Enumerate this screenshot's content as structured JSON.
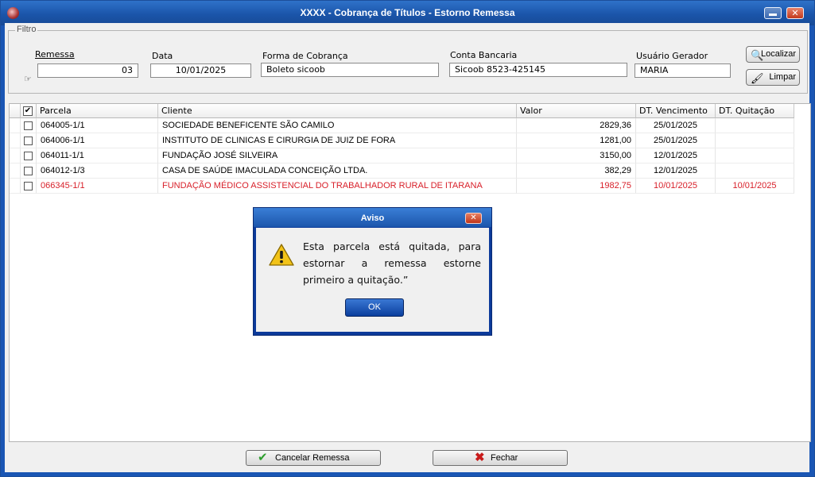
{
  "window": {
    "title": "XXXX - Cobrança de Títulos - Estorno Remessa",
    "close_glyph": "✕"
  },
  "filter": {
    "legend": "Filtro",
    "remessa_label": "Remessa",
    "remessa_value": "03",
    "data_label": "Data",
    "data_value": "10/01/2025",
    "forma_label": "Forma de Cobrança",
    "forma_value": "Boleto sicoob",
    "conta_label": "Conta Bancaria",
    "conta_value": "Sicoob 8523-425145",
    "usuario_label": "Usuário Gerador",
    "usuario_value": "MARIA",
    "localizar_label": "Localizar",
    "limpar_label": "Limpar"
  },
  "grid": {
    "header_check": "✔",
    "columns": [
      "Parcela",
      "Cliente",
      "Valor",
      "DT. Vencimento",
      "DT. Quitação"
    ],
    "rows": [
      {
        "parcela": "064005-1/1",
        "cliente": "SOCIEDADE BENEFICENTE SÃO CAMILO",
        "valor": "2829,36",
        "vencimento": "25/01/2025",
        "quitacao": ""
      },
      {
        "parcela": "064006-1/1",
        "cliente": "INSTITUTO DE CLINICAS E CIRURGIA DE JUIZ DE FORA",
        "valor": "1281,00",
        "vencimento": "25/01/2025",
        "quitacao": ""
      },
      {
        "parcela": "064011-1/1",
        "cliente": "FUNDAÇÃO JOSÉ SILVEIRA",
        "valor": "3150,00",
        "vencimento": "12/01/2025",
        "quitacao": ""
      },
      {
        "parcela": "064012-1/3",
        "cliente": "CASA DE SAÚDE IMACULADA CONCEIÇÃO LTDA.",
        "valor": "382,29",
        "vencimento": "12/01/2025",
        "quitacao": ""
      },
      {
        "parcela": "066345-1/1",
        "cliente": "FUNDAÇÃO MÉDICO ASSISTENCIAL DO TRABALHADOR RURAL DE ITARANA",
        "valor": "1982,75",
        "vencimento": "10/01/2025",
        "quitacao": "10/01/2025"
      }
    ]
  },
  "buttons": {
    "cancelar": "Cancelar Remessa",
    "fechar": "Fechar"
  },
  "dialog": {
    "title": "Aviso",
    "message": "Esta parcela está quitada, para estornar a remessa estorne primeiro a quitação.”",
    "ok": "OK",
    "close_glyph": "✕"
  },
  "colors": {
    "title_blue": "#1b55aa",
    "highlight_red": "#d8202a",
    "panel_gray": "#f0f0f0"
  }
}
